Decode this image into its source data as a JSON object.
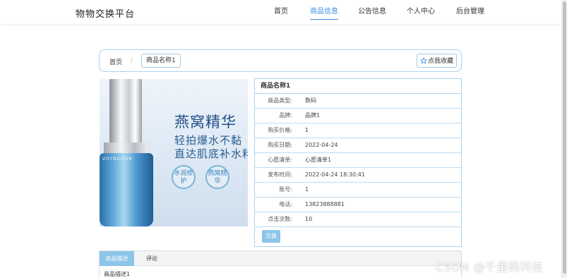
{
  "header": {
    "logo": "物物交换平台",
    "nav": [
      {
        "label": "首页",
        "active": false
      },
      {
        "label": "商品信息",
        "active": true
      },
      {
        "label": "公告信息",
        "active": false
      },
      {
        "label": "个人中心",
        "active": false
      },
      {
        "label": "后台管理",
        "active": false
      }
    ]
  },
  "breadcrumb": {
    "home": "首页",
    "separator": "/",
    "current": "商品名称1"
  },
  "favorite_button": {
    "icon": "star-icon",
    "label": "点我收藏"
  },
  "product_image": {
    "ad_line1": "燕窝精华",
    "ad_line2": "轻拍爆水不黏",
    "ad_line3": "直达肌底补水料",
    "badge1": "水润修护",
    "badge2": "燕窝精华",
    "bottle_text": "VOYNUDON"
  },
  "info": {
    "title": "商品名称1",
    "rows": [
      {
        "label": "商品类型:",
        "value": "数码"
      },
      {
        "label": "品牌:",
        "value": "品牌1"
      },
      {
        "label": "购买价格:",
        "value": "1"
      },
      {
        "label": "购买日期:",
        "value": "2022-04-24"
      },
      {
        "label": "心愿清单:",
        "value": "心愿清单1"
      },
      {
        "label": "发布时间:",
        "value": "2022-04-24 18:30:41"
      },
      {
        "label": "账号:",
        "value": "1"
      },
      {
        "label": "电话:",
        "value": "13823888881"
      },
      {
        "label": "点击次数:",
        "value": "10"
      }
    ],
    "exchange_button": "交换"
  },
  "tabs": {
    "items": [
      "商品描述",
      "评论"
    ],
    "content": "商品描述1"
  },
  "watermark": "CSDN @千里码科技",
  "colors": {
    "accent": "#3a8ee6",
    "border": "#a9d3f0",
    "button": "#8cc5e8"
  }
}
